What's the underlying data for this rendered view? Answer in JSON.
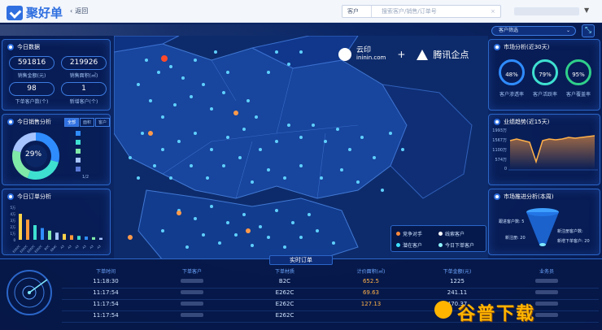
{
  "app": {
    "logo_text": "聚好单",
    "back_label": "返回"
  },
  "search": {
    "type_value": "客户",
    "placeholder": "搜索客户/销售/订单号"
  },
  "today_data": {
    "title": "今日数据",
    "stats": [
      {
        "value": "591816",
        "label": "销售金额(元)"
      },
      {
        "value": "219926",
        "label": "销售面积(㎡)"
      },
      {
        "value": "98",
        "label": "下单客户数(个)"
      },
      {
        "value": "1",
        "label": "新增客户(个)"
      }
    ]
  },
  "today_sales": {
    "title": "今日销售分析",
    "tabs": [
      "全部",
      "面积",
      "客户"
    ],
    "percent": "29%",
    "page": "1/2",
    "legend_count": 5
  },
  "today_orders": {
    "title": "今日订单分析",
    "y_ticks": [
      "5万",
      "4万",
      "3万",
      "2万",
      "1万",
      "0"
    ],
    "categories": [
      "E262C",
      "E262C",
      "E262C",
      "E262C",
      "B2C",
      "EB4C",
      "A3",
      "A3",
      "A3",
      "A3",
      "A3",
      "A3"
    ]
  },
  "brand": {
    "partner1_name": "云印",
    "partner1_url": "ininin.com",
    "plus": "+",
    "partner2_name": "腾讯企点"
  },
  "legend": {
    "items": [
      {
        "label": "竞争对手",
        "color": "#ff8a3a"
      },
      {
        "label": "线索客户",
        "color": "#ffffff"
      },
      {
        "label": "潜在客户",
        "color": "#3ee0ff"
      },
      {
        "label": "今日下单客户",
        "color": "#8ef5ff"
      }
    ]
  },
  "filter": {
    "label": "客户筛选"
  },
  "market": {
    "title": "市场分析(近30天)",
    "gauges": [
      {
        "value": "48%",
        "label": "客户渗透率",
        "color": "#2f8cff"
      },
      {
        "value": "79%",
        "label": "客户活跃率",
        "color": "#3ee0d0"
      },
      {
        "value": "95%",
        "label": "客户覆盖率",
        "color": "#2fcf8a"
      }
    ]
  },
  "trend": {
    "title": "业绩趋势(近15天)",
    "y_ticks": [
      "1993万",
      "1567万",
      "1100万",
      "574万",
      "0"
    ]
  },
  "push": {
    "title": "市场推进分析(本周)",
    "labels": [
      "跟进客户数: 5",
      "新注册客户数:",
      "新增下单客户: 20",
      "新注册: 20"
    ]
  },
  "orders": {
    "title": "实时订单",
    "headers": [
      "下单时间",
      "下单客户",
      "下单材质",
      "计价面积(㎡)",
      "下单金额(元)",
      "业务员"
    ],
    "rows": [
      {
        "time": "11:18:30",
        "material": "B2C",
        "area": "652.5",
        "amount": "1225"
      },
      {
        "time": "11:17:54",
        "material": "E262C",
        "area": "69.63",
        "amount": "241.11"
      },
      {
        "time": "11:17:54",
        "material": "E262C",
        "area": "127.13",
        "amount": "470.37"
      },
      {
        "time": "11:17:54",
        "material": "E262C",
        "area": "",
        "amount": ""
      }
    ]
  },
  "watermark": {
    "text": "谷普下载"
  }
}
